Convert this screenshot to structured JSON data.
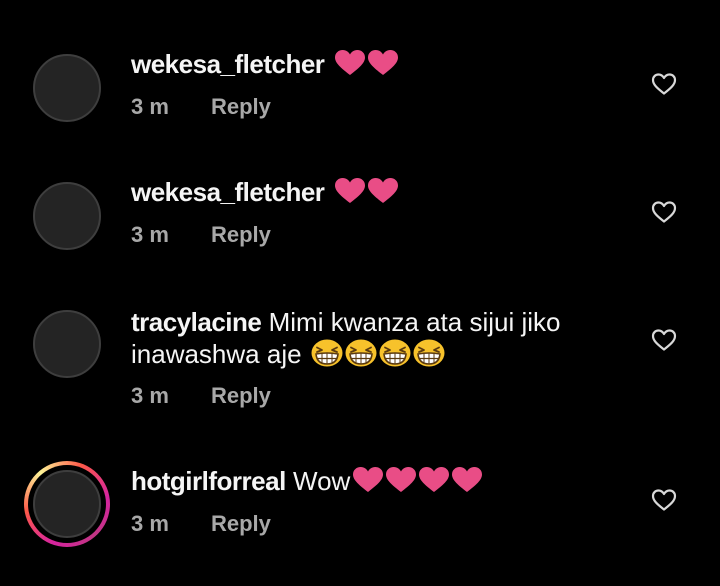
{
  "comments": [
    {
      "username": "wekesa_fletcher",
      "text": "",
      "emojis": [
        "red-heart-emoji",
        "red-heart-emoji"
      ],
      "time": "3 m",
      "reply_label": "Reply"
    },
    {
      "username": "wekesa_fletcher",
      "text": "",
      "emojis": [
        "red-heart-emoji",
        "red-heart-emoji"
      ],
      "time": "3 m",
      "reply_label": "Reply"
    },
    {
      "username": "tracylacine",
      "text_line1": "Mimi kwanza ata sijui jiko",
      "text_line2": "inawashwa aje",
      "emojis": [
        "grinning-squinting-face-emoji",
        "grinning-squinting-face-emoji",
        "grinning-squinting-face-emoji",
        "grinning-squinting-face-emoji"
      ],
      "time": "3 m",
      "reply_label": "Reply"
    },
    {
      "username": "hotgirlforreal",
      "text": "Wow",
      "emojis": [
        "red-heart-emoji",
        "red-heart-emoji",
        "red-heart-emoji",
        "red-heart-emoji"
      ],
      "time": "3 m",
      "reply_label": "Reply",
      "has_story_ring": true
    }
  ],
  "colors": {
    "background": "#000000",
    "heart_emoji": "#e94d86",
    "meta_text": "#a8a8a8",
    "avatar_fill": "#242424"
  },
  "icons": {
    "like": "heart-outline-icon"
  }
}
